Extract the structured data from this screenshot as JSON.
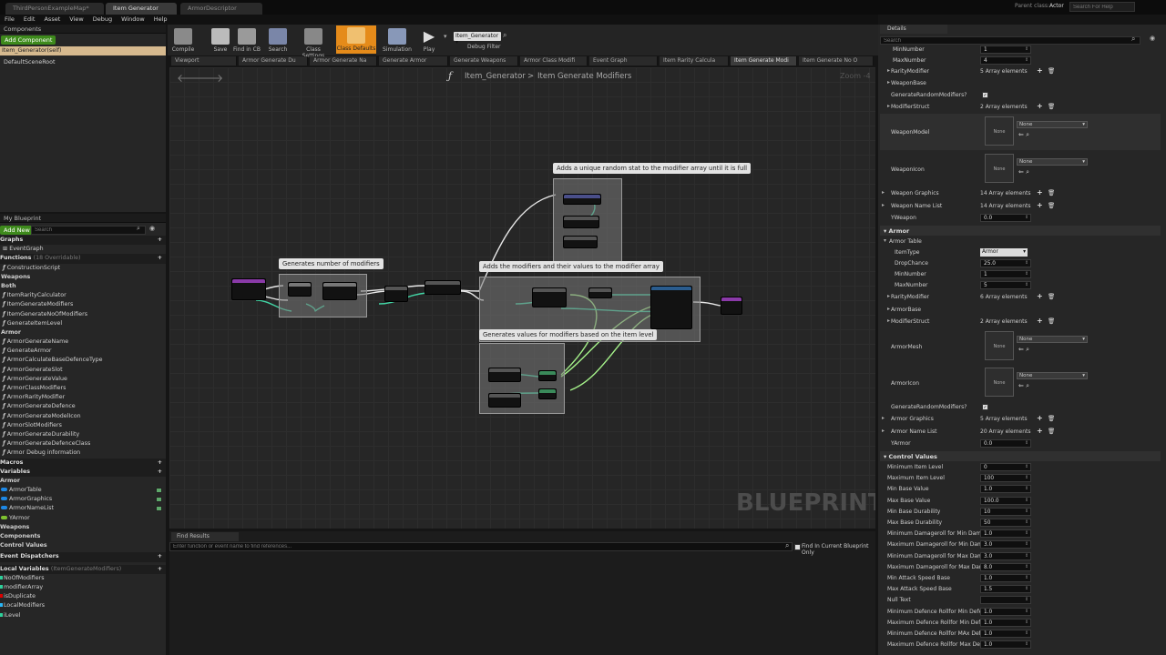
{
  "doc_tabs": [
    "ThirdPersonExampleMap*",
    "Item Generator",
    "ArmorDescriptor"
  ],
  "top_right": {
    "parent_class_label": "Parent class:",
    "parent_class": "Actor",
    "search_placeholder": "Search For Help"
  },
  "menu": [
    "File",
    "Edit",
    "Asset",
    "View",
    "Debug",
    "Window",
    "Help"
  ],
  "toolbar": {
    "compile": "Compile",
    "save": "Save",
    "find_in_cb": "Find in CB",
    "search": "Search",
    "class_settings": "Class Settings",
    "class_defaults": "Class Defaults",
    "simulation": "Simulation",
    "play": "Play",
    "debug_object": "Item_Generator",
    "debug_filter": "Debug Filter"
  },
  "components": {
    "title": "Components",
    "add": "Add Component",
    "self": "Item_Generator(self)",
    "root": "DefaultSceneRoot"
  },
  "my_blueprint": {
    "title": "My Blueprint",
    "add_new": "Add New",
    "search_placeholder": "Search",
    "graphs_label": "Graphs",
    "event_graph": "EventGraph",
    "functions_label": "Functions",
    "functions_count": "(18 Overridable)",
    "functions": [
      "ConstructionScript",
      "Weapons",
      "Both",
      "ItemRarityCalculator",
      "ItemGenerateModifiers",
      "ItemGenerateNoOfModifiers",
      "GenerateItemLevel",
      "Armor",
      "ArmorGenerateName",
      "GenerateArmor",
      "ArmorCalculateBaseDefenceType",
      "ArmorGenerateSlot",
      "ArmorGenerateValue",
      "ArmorClassModifiers",
      "ArmorRarityModifier",
      "ArmorGenerateDefence",
      "ArmorGenerateModelIcon",
      "ArmorSlotModifiers",
      "ArmorGenerateDurability",
      "ArmorGenerateDefenceClass",
      "Armor Debug information"
    ],
    "macros_label": "Macros",
    "variables_label": "Variables",
    "variables": [
      "Armor",
      "ArmorTable",
      "ArmorGraphics",
      "ArmorNameList",
      "YArmor",
      "Weapons",
      "Components",
      "Control Values"
    ],
    "event_dispatchers_label": "Event Dispatchers",
    "local_variables_label": "Local Variables",
    "local_variables_sub": "(ItemGenerateModifiers)",
    "local_variables": [
      "NoOfModifiers",
      "modifierArray",
      "isDuplicate",
      "LocalModifiers",
      "iLevel"
    ]
  },
  "graph_tabs": [
    "Viewport",
    "Armor Generate Du",
    "Armor Generate Na",
    "Generate Armor",
    "Generate Weapons",
    "Armor Class Modifi",
    "Event Graph",
    "Item Rarity Calcula",
    "Item Generate Modi",
    "Item Generate No O"
  ],
  "breadcrumb": {
    "root": "Item_Generator",
    "sep": ">",
    "current": "Item Generate Modifiers"
  },
  "zoom": "Zoom -4",
  "watermark": "BLUEPRINT",
  "comments": {
    "c1": "Adds a unique random stat to the modifier array until it is full",
    "c2": "Generates number of modifiers",
    "c3": "Adds the modifiers and their values to the modifier array",
    "c4": "Generates values for modifiers based on the item level"
  },
  "find_results": {
    "title": "Find Results",
    "placeholder": "Enter function or event name to find references...",
    "checkbox_label": "Find In Current Blueprint Only"
  },
  "details": {
    "title": "Details",
    "search_placeholder": "Search",
    "weapon_rows": [
      [
        "MinNumber",
        "1"
      ],
      [
        "MaxNumber",
        "4"
      ]
    ],
    "rarity_modifier": [
      "RarityModifier",
      "5 Array elements"
    ],
    "weapon_base": "WeaponBase",
    "gen_random_mods": "GenerateRandomModifiers?",
    "modifier_struct": [
      "ModifierStruct",
      "2 Array elements"
    ],
    "weapon_model": "WeaponModel",
    "weapon_icon": "WeaponIcon",
    "none": "None",
    "weapon_graphics": [
      "Weapon Graphics",
      "14 Array elements"
    ],
    "weapon_name_list": [
      "Weapon Name List",
      "14 Array elements"
    ],
    "yweapon": [
      "YWeapon",
      "0.0"
    ],
    "armor_sec": "Armor",
    "armor_table": "Armor Table",
    "item_type": [
      "ItemType",
      "Armor"
    ],
    "armor_rows": [
      [
        "DropChance",
        "25.0"
      ],
      [
        "MinNumber",
        "1"
      ],
      [
        "MaxNumber",
        "5"
      ]
    ],
    "armor_rarity": [
      "RarityModifier",
      "6 Array elements"
    ],
    "armor_base": "ArmorBase",
    "armor_mod_struct": [
      "ModifierStruct",
      "2 Array elements"
    ],
    "armor_mesh": "ArmorMesh",
    "armor_icon": "ArmorIcon",
    "armor_graphics": [
      "Armor Graphics",
      "5 Array elements"
    ],
    "armor_name_list": [
      "Armor Name List",
      "20 Array elements"
    ],
    "yarmor": [
      "YArmor",
      "0.0"
    ],
    "control_sec": "Control Values",
    "control_rows": [
      [
        "Minimum Item Level",
        "0"
      ],
      [
        "Maximum Item Level",
        "100"
      ],
      [
        "Min Base Value",
        "1.0"
      ],
      [
        "Max Base Value",
        "100.0"
      ],
      [
        "Min Base Durability",
        "10"
      ],
      [
        "Max Base Durability",
        "50"
      ],
      [
        "Minimum Damageroll for Min Damage",
        "1.0"
      ],
      [
        "Maximum Damageroll for Min Damage",
        "3.0"
      ],
      [
        "Minimum Damageroll for Max Damage",
        "3.0"
      ],
      [
        "Maximum Damageroll for Max Damage",
        "8.0"
      ],
      [
        "Min Attack Speed Base",
        "1.0"
      ],
      [
        "Max Attack Speed Base",
        "1.5"
      ],
      [
        "Null Text",
        ""
      ],
      [
        "Minimum Defence Rollfor Min Defence",
        "1.0"
      ],
      [
        "Maximum Defence Rollfor Min Defence",
        "1.0"
      ],
      [
        "Minimum Defence Rollfor MAx Defence",
        "1.0"
      ],
      [
        "Maximum Defence Rollfor Max Defence",
        "1.0"
      ]
    ]
  }
}
